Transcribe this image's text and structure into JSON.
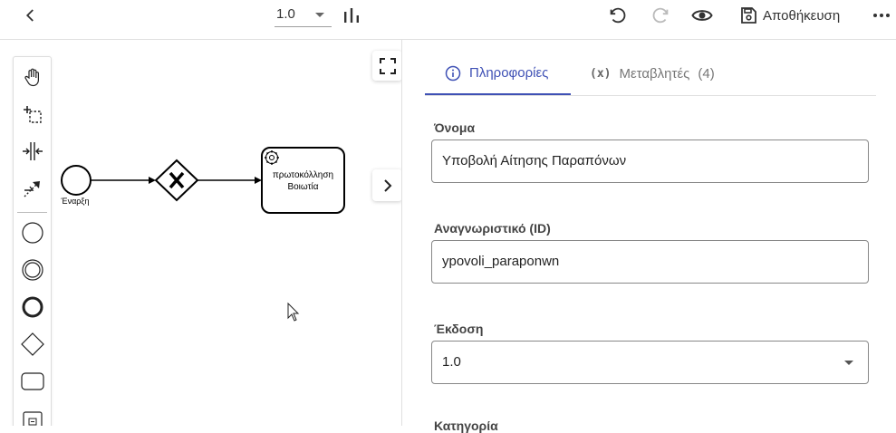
{
  "toolbar": {
    "version": "1.0",
    "save_label": "Αποθήκευση"
  },
  "diagram": {
    "start_event_label": "Έναρξη",
    "task_label_line1": "πρωτοκόλληση",
    "task_label_line2": "Βοιωτία"
  },
  "panel": {
    "tabs": [
      {
        "label": "Πληροφορίες",
        "icon": "info-icon"
      },
      {
        "label": "Μεταβλητές",
        "icon": "variable-icon",
        "icon_text": "(x)",
        "count": "(4)"
      }
    ],
    "fields": {
      "name_label": "Όνομα",
      "name_value": "Υποβολή Αίτησης Παραπόνων",
      "id_label": "Αναγνωριστικό (ID)",
      "id_value": "ypovoli_paraponwn",
      "version_label": "Έκδοση",
      "version_value": "1.0",
      "category_label": "Κατηγορία"
    }
  },
  "colors": {
    "accent": "#3f51b5",
    "border": "#e0e0e0"
  }
}
